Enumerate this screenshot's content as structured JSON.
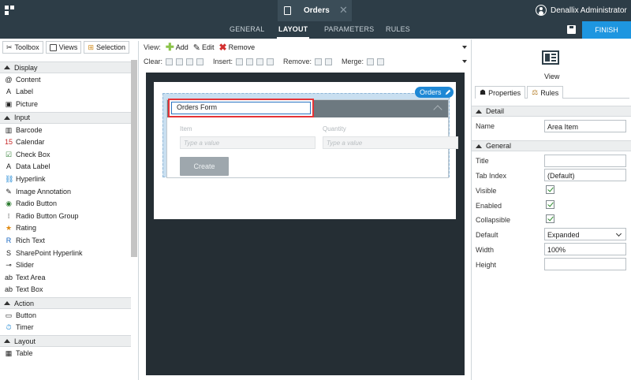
{
  "window": {
    "doc_title": "Orders",
    "user_name": "Denallix Administrator"
  },
  "nav": {
    "tabs": [
      {
        "label": "GENERAL"
      },
      {
        "label": "LAYOUT"
      },
      {
        "label": "PARAMETERS"
      },
      {
        "label": "RULES"
      }
    ],
    "finish_label": "FINISH"
  },
  "left": {
    "tabs": [
      {
        "label": "Toolbox",
        "icon": "toolbox-icon"
      },
      {
        "label": "Views",
        "icon": "views-icon"
      },
      {
        "label": "Selection",
        "icon": "selection-icon"
      }
    ],
    "categories": [
      {
        "label": "Display",
        "items": [
          {
            "label": "Content",
            "icon": "@"
          },
          {
            "label": "Label",
            "icon": "A"
          },
          {
            "label": "Picture",
            "icon": "▣"
          }
        ]
      },
      {
        "label": "Input",
        "items": [
          {
            "label": "Barcode",
            "icon": "▥"
          },
          {
            "label": "Calendar",
            "icon": "15"
          },
          {
            "label": "Check Box",
            "icon": "☑"
          },
          {
            "label": "Data Label",
            "icon": "A"
          },
          {
            "label": "Hyperlink",
            "icon": "⛓"
          },
          {
            "label": "Image Annotation",
            "icon": "✎"
          },
          {
            "label": "Radio Button",
            "icon": "◉"
          },
          {
            "label": "Radio Button Group",
            "icon": "⁝"
          },
          {
            "label": "Rating",
            "icon": "★"
          },
          {
            "label": "Rich Text",
            "icon": "R"
          },
          {
            "label": "SharePoint Hyperlink",
            "icon": "S"
          },
          {
            "label": "Slider",
            "icon": "⊸"
          },
          {
            "label": "Text Area",
            "icon": "ab"
          },
          {
            "label": "Text Box",
            "icon": "ab"
          }
        ]
      },
      {
        "label": "Action",
        "items": [
          {
            "label": "Button",
            "icon": "▭"
          },
          {
            "label": "Timer",
            "icon": "⏱"
          }
        ]
      },
      {
        "label": "Layout",
        "items": [
          {
            "label": "Table",
            "icon": "▦"
          }
        ]
      }
    ]
  },
  "toolbar": {
    "view_label": "View:",
    "add_label": "Add",
    "edit_label": "Edit",
    "remove_label": "Remove",
    "clear_label": "Clear:",
    "insert_label": "Insert:",
    "remove2_label": "Remove:",
    "merge_label": "Merge:"
  },
  "canvas": {
    "area_tag": "Orders",
    "form_title": "Orders Form",
    "field1_label": "Item",
    "field1_placeholder": "Type a value",
    "field2_label": "Quantity",
    "field2_placeholder": "Type a value",
    "create_label": "Create"
  },
  "right": {
    "view_label": "View",
    "tabs": [
      {
        "label": "Properties"
      },
      {
        "label": "Rules"
      }
    ],
    "detail_label": "Detail",
    "name_label": "Name",
    "name_value": "Area Item",
    "general_label": "General",
    "title_label": "Title",
    "title_value": "",
    "tabindex_label": "Tab Index",
    "tabindex_value": "(Default)",
    "visible_label": "Visible",
    "enabled_label": "Enabled",
    "collapsible_label": "Collapsible",
    "default_label": "Default",
    "default_value": "Expanded",
    "width_label": "Width",
    "width_value": "100%",
    "height_label": "Height",
    "height_value": ""
  }
}
